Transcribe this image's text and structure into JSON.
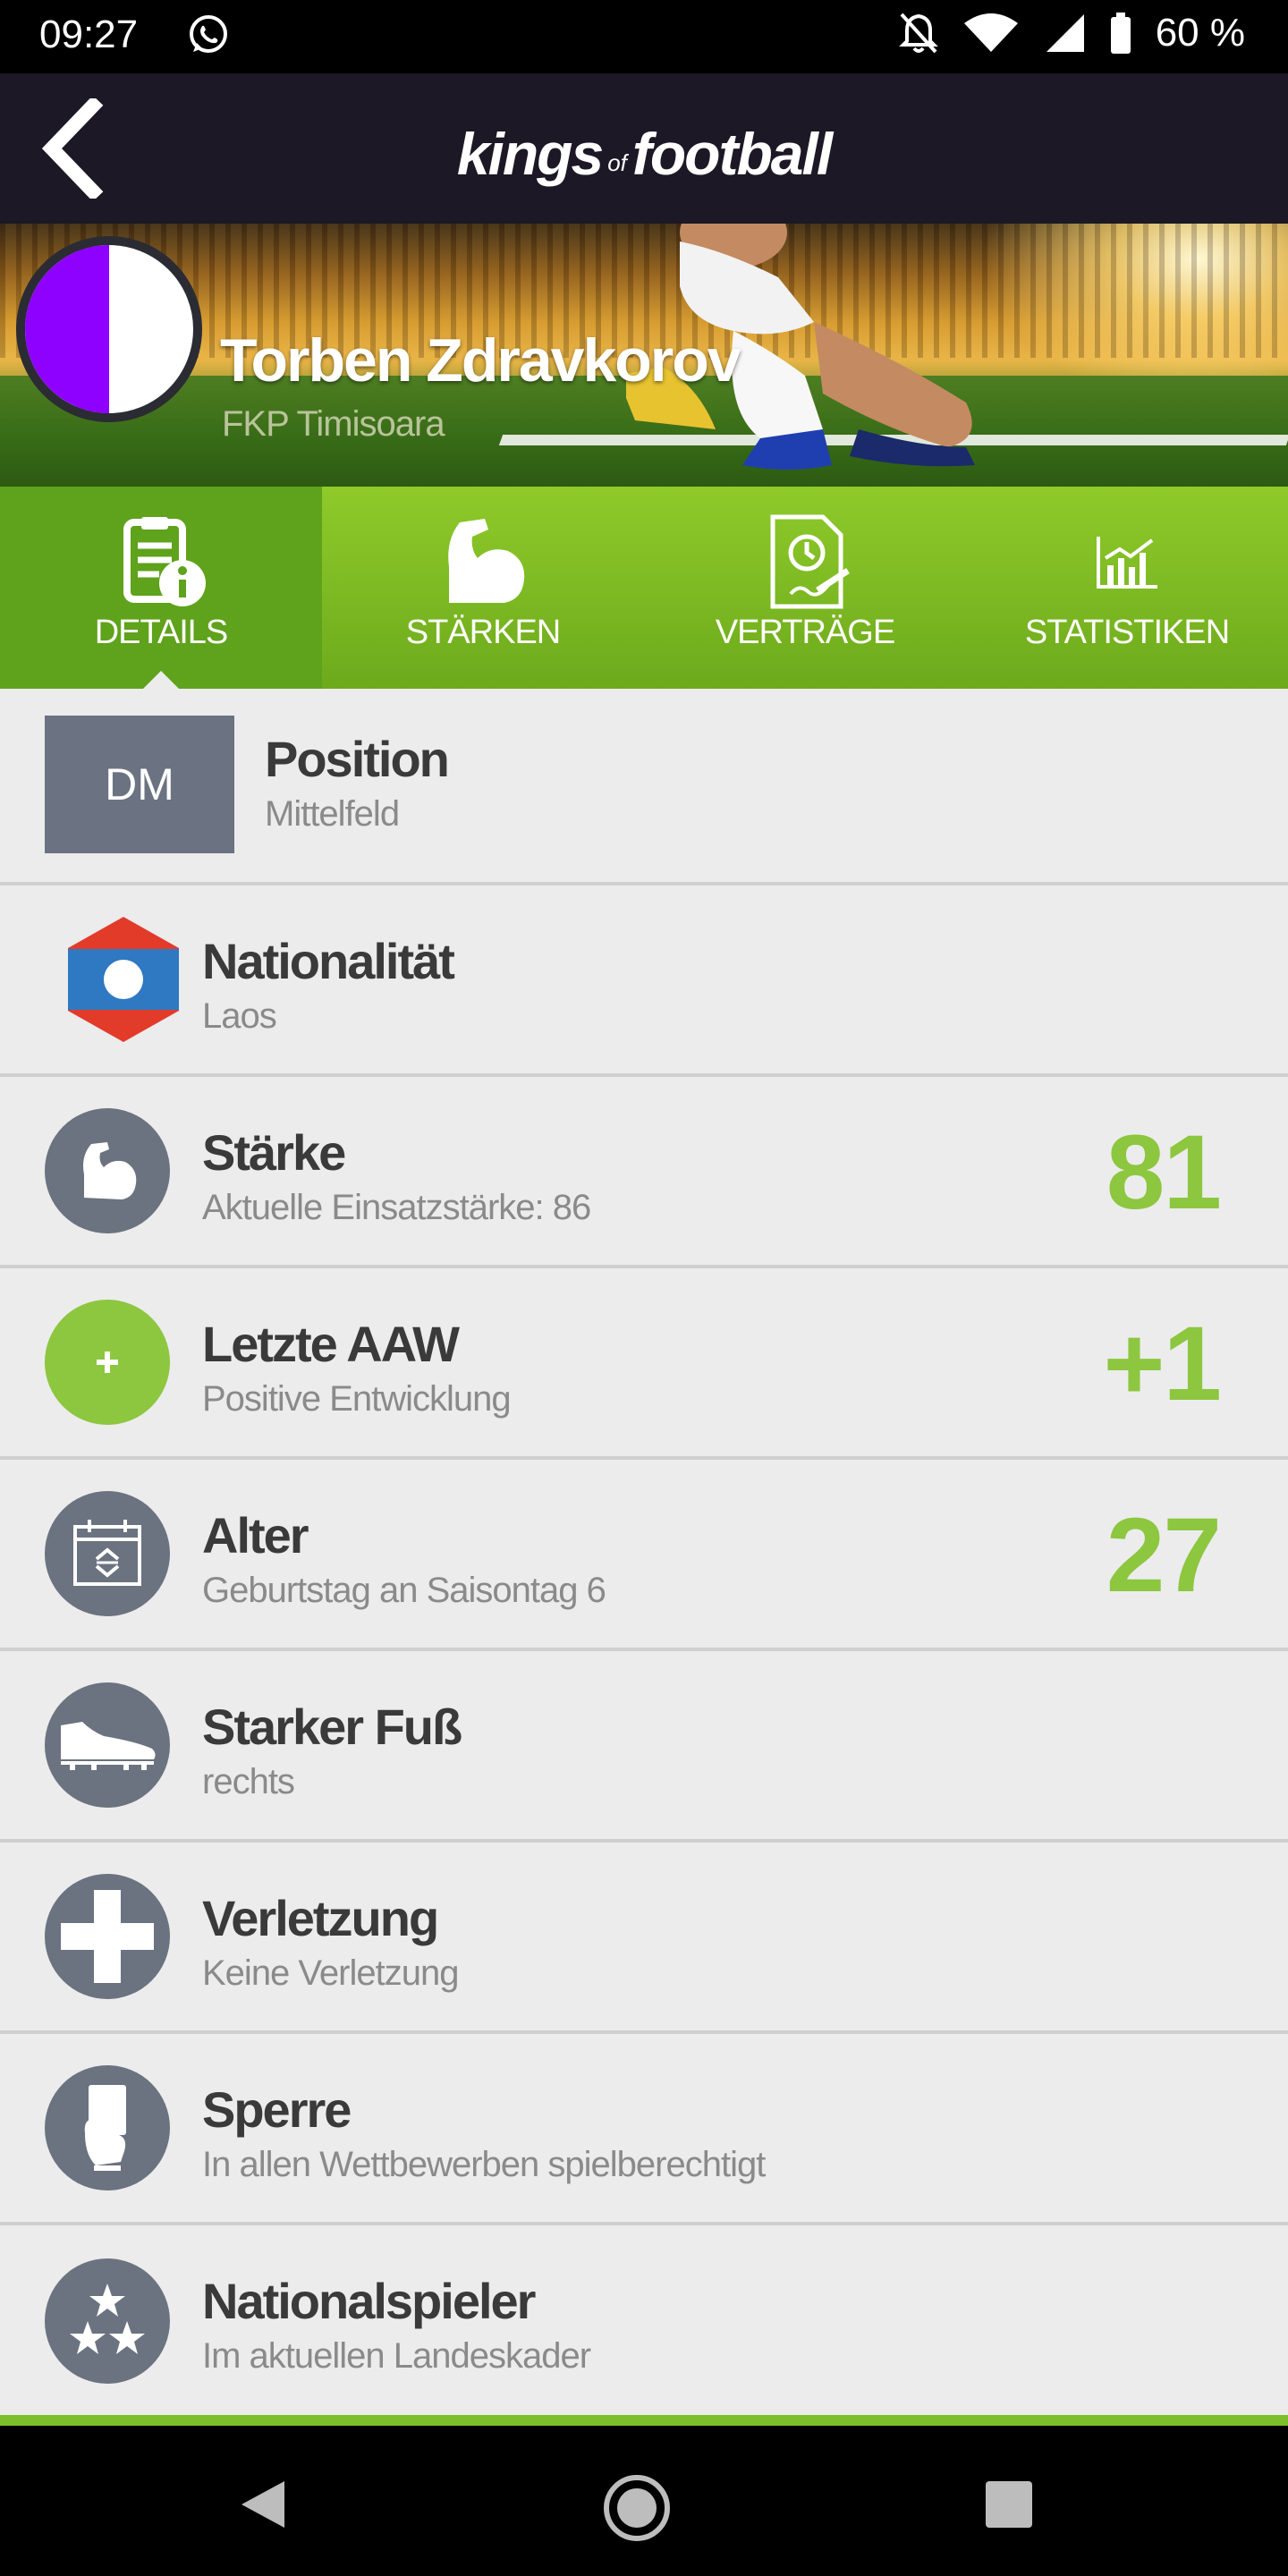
{
  "status_bar": {
    "time": "09:27",
    "battery_percent": "60 %",
    "icons": [
      "whatsapp-icon",
      "notifications-off-icon",
      "wifi-icon",
      "signal-icon",
      "battery-icon"
    ]
  },
  "header": {
    "logo_part1": "kings",
    "logo_of": "of",
    "logo_part2": "football",
    "back_icon": "chevron-left-icon"
  },
  "player": {
    "name": "Torben Zdravkorov",
    "club": "FKP Timisoara",
    "club_colors": [
      "#8e00ff",
      "#ffffff"
    ]
  },
  "tabs": [
    {
      "label": "DETAILS",
      "icon": "details-icon",
      "active": true
    },
    {
      "label": "STÄRKEN",
      "icon": "bicep-icon",
      "active": false
    },
    {
      "label": "VERTRÄGE",
      "icon": "contract-icon",
      "active": false
    },
    {
      "label": "STATISTIKEN",
      "icon": "stats-icon",
      "active": false
    }
  ],
  "details": [
    {
      "title": "Position",
      "subtitle": "Mittelfeld",
      "badge": "DM"
    },
    {
      "title": "Nationalität",
      "subtitle": "Laos",
      "icon": "laos-flag-icon"
    },
    {
      "title": "Stärke",
      "subtitle": "Aktuelle Einsatzstärke: 86",
      "value": "81",
      "icon": "bicep-icon"
    },
    {
      "title": "Letzte AAW",
      "subtitle": "Positive Entwicklung",
      "value": "+1",
      "icon": "plus-icon"
    },
    {
      "title": "Alter",
      "subtitle": "Geburtstag an Saisontag 6",
      "value": "27",
      "icon": "calendar-icon"
    },
    {
      "title": "Starker Fuß",
      "subtitle": "rechts",
      "icon": "boot-icon"
    },
    {
      "title": "Verletzung",
      "subtitle": "Keine Verletzung",
      "icon": "medical-cross-icon"
    },
    {
      "title": "Sperre",
      "subtitle": "In allen Wettbewerben spielberechtigt",
      "icon": "referee-card-icon"
    },
    {
      "title": "Nationalspieler",
      "subtitle": "Im aktuellen Landeskader",
      "icon": "stars-icon"
    }
  ],
  "colors": {
    "accent_green": "#8dc63f",
    "header_dark": "#1c1825",
    "icon_gray": "#6b7280"
  }
}
